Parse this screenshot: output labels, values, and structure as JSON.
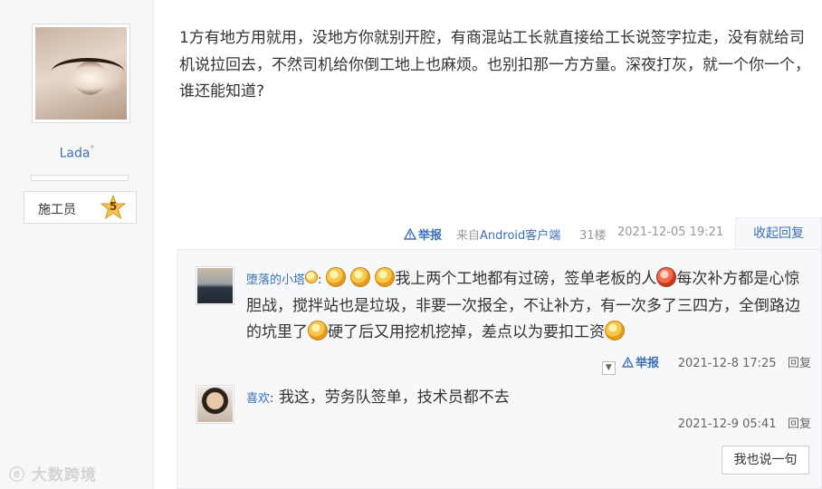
{
  "author": {
    "name": "Lada",
    "name_suffix": "°",
    "rank_label": "施工员",
    "rank_level": "5"
  },
  "post": {
    "text": "1方有地方用就用，没地方你就别开腔，有商混站工长就直接给工长说签字拉走，没有就给司机说拉回去，不然司机给你倒工地上也麻烦。也别扣那一方方量。深夜打灰，就一个你一个，谁还能知道?",
    "report_label": "举报",
    "source_prefix": "来自",
    "source_app": "Android客户端",
    "floor": "31楼",
    "time": "2021-12-05 19:21",
    "collapse_label": "收起回复"
  },
  "replies": [
    {
      "user": "堕落的小塔",
      "text_1": "我上两个工地都有过磅，签单老板的人",
      "text_2": "每次补方都是心惊胆战，搅拌站也是垃圾，非要一次报全，不让补方，有一次多了三四方，全倒路边的坑里了",
      "text_3": "硬了后又用挖机挖掉，差点以为要扣工资",
      "report_label": "举报",
      "time": "2021-12-8 17:25",
      "reply_label": "回复"
    },
    {
      "user": "喜欢",
      "separator": ":",
      "text": "我这，劳务队签单，技术员都不去",
      "time": "2021-12-9 05:41",
      "reply_label": "回复"
    }
  ],
  "speak_button": "我也说一句",
  "watermark": "大数跨境",
  "icons": [
    "warning-icon",
    "emoji-icon",
    "dropdown-icon",
    "star-badge-icon"
  ],
  "colors": {
    "link": "#3a6fb7",
    "meta": "#999999",
    "reply_bg": "#f7f8fa"
  }
}
